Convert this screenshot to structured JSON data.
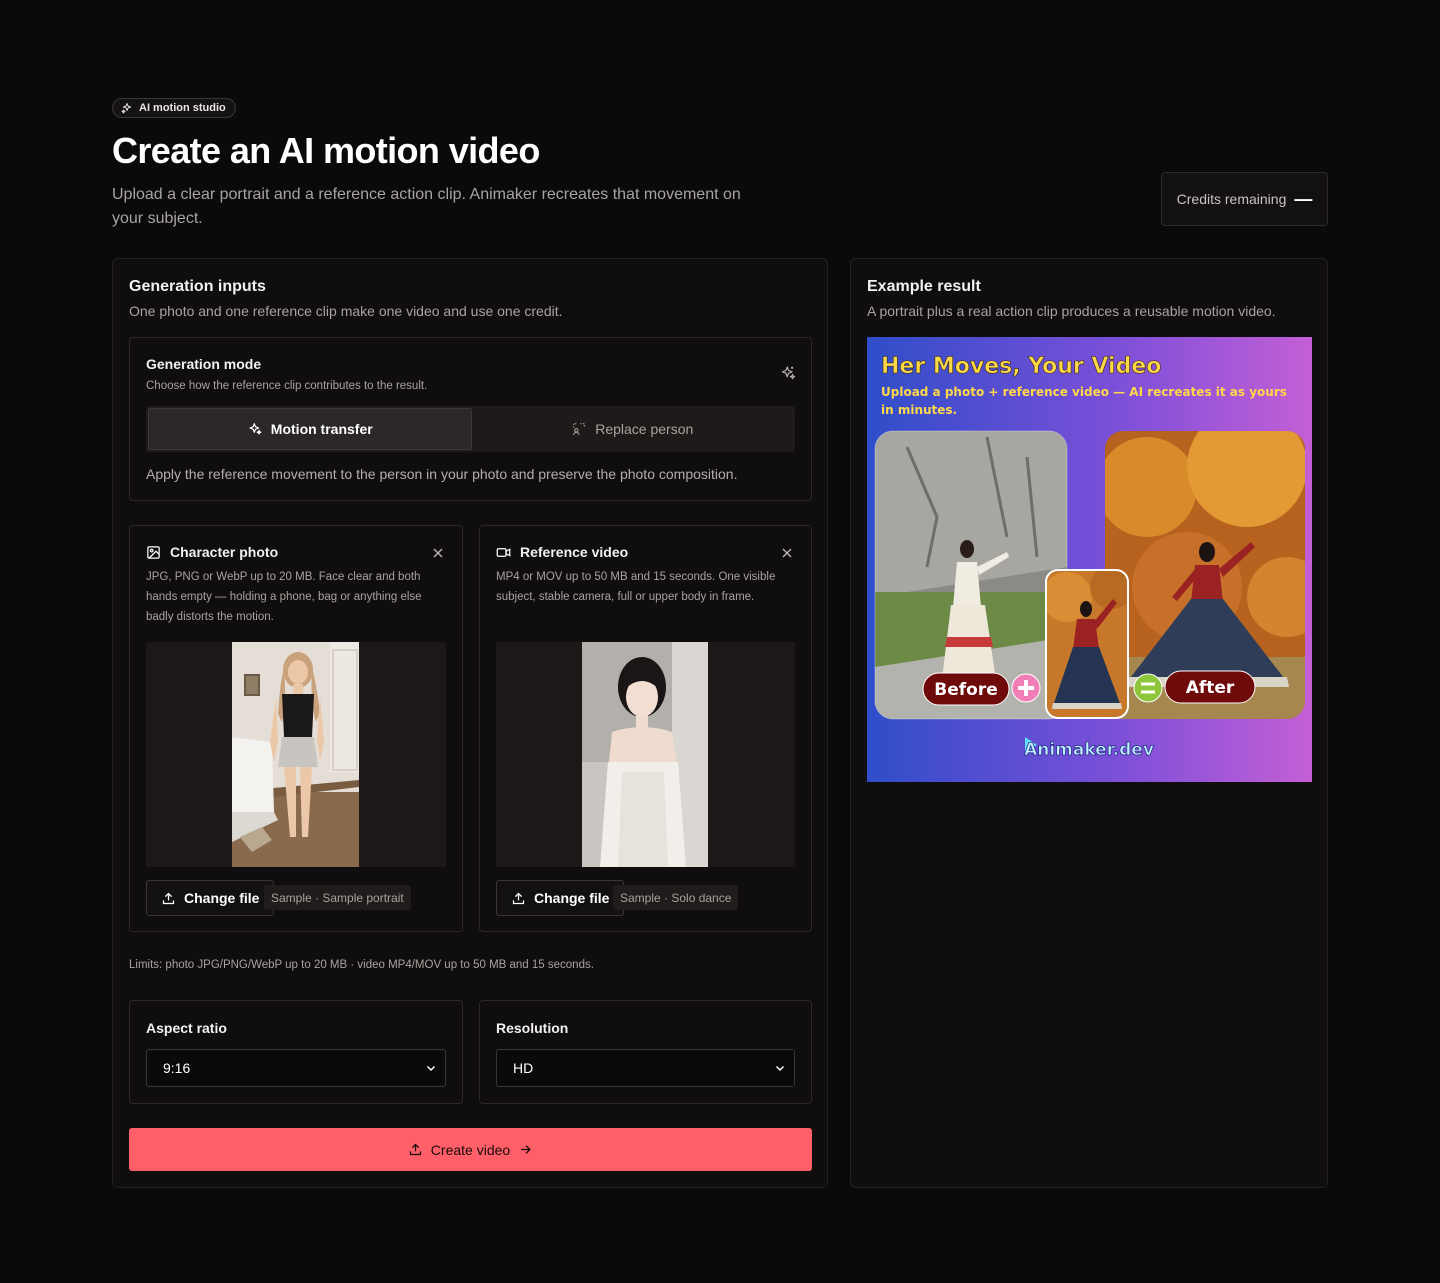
{
  "header": {
    "pill": "AI motion studio",
    "title": "Create an AI motion video",
    "subtitle": "Upload a clear portrait and a reference action clip. Animaker recreates that movement on your subject.",
    "credits_label": "Credits remaining",
    "credits_value": "—"
  },
  "inputs": {
    "title": "Generation inputs",
    "description": "One photo and one reference clip make one video and use one credit."
  },
  "mode": {
    "title": "Generation mode",
    "description": "Choose how the reference clip contributes to the result.",
    "options": [
      "Motion transfer",
      "Replace person"
    ],
    "selected": "Motion transfer",
    "note": "Apply the reference movement to the person in your photo and preserve the photo composition."
  },
  "character": {
    "title": "Character photo",
    "description": "JPG, PNG or WebP up to 20 MB. Face clear and both hands empty — holding a phone, bag or anything else badly distorts the motion.",
    "button": "Change file",
    "sample": "Sample · Sample portrait"
  },
  "reference": {
    "title": "Reference video",
    "description": "MP4 or MOV up to 50 MB and 15 seconds. One visible subject, stable camera, full or upper body in frame.",
    "button": "Change file",
    "sample": "Sample · Solo dance"
  },
  "limits": "Limits: photo JPG/PNG/WebP up to 20 MB · video MP4/MOV up to 50 MB and 15 seconds.",
  "aspect": {
    "label": "Aspect ratio",
    "value": "9:16"
  },
  "resolution": {
    "label": "Resolution",
    "value": "HD"
  },
  "create_button": "Create video",
  "example": {
    "title": "Example result",
    "description": "A portrait plus a real action clip produces a reusable motion video.",
    "banner_title": "Her Moves, Your Video",
    "banner_sub_line1": "Upload a photo + reference video — AI recreates it as yours",
    "banner_sub_line2": "in minutes.",
    "before_label": "Before",
    "after_label": "After",
    "brand": "Animaker.dev"
  },
  "colors": {
    "accent": "#ff5f68",
    "background": "#0b0a0a",
    "panel": "#0f0d0d"
  }
}
